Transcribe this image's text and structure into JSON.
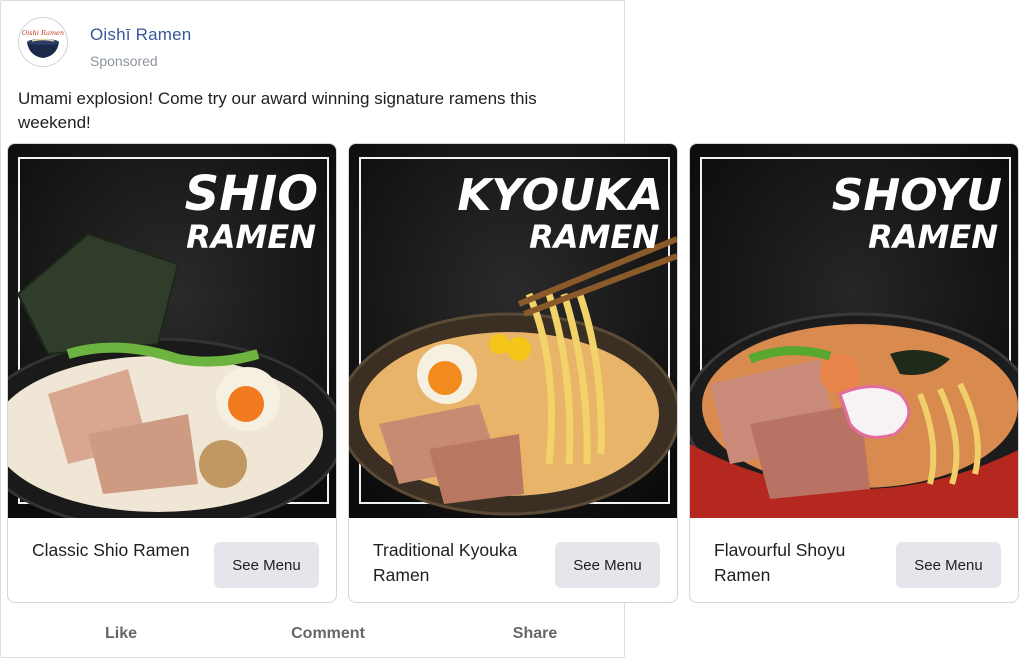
{
  "post": {
    "page_name": "Oishī Ramen",
    "avatar_text": "Oishi Ramen",
    "sponsored_label": "Sponsored",
    "caption": "Umami explosion! Come try our award winning signature ramens this weekend!"
  },
  "cards": [
    {
      "title": "Classic Shio Ramen",
      "image_line1": "SHIO",
      "image_line2": "RAMEN",
      "button_label": "See Menu",
      "broth_color": "#efe6d6"
    },
    {
      "title": "Traditional Kyouka Ramen",
      "image_line1": "KYOUKA",
      "image_line2": "RAMEN",
      "button_label": "See Menu",
      "broth_color": "#e8b46a"
    },
    {
      "title": "Flavourful Shoyu Ramen",
      "image_line1": "SHOYU",
      "image_line2": "RAMEN",
      "button_label": "See Menu",
      "broth_color": "#d98a4e"
    }
  ],
  "actions": {
    "like": "Like",
    "comment": "Comment",
    "share": "Share"
  },
  "colors": {
    "page_name": "#385898",
    "button_bg": "#e4e6eb",
    "action_text": "#65676b"
  }
}
